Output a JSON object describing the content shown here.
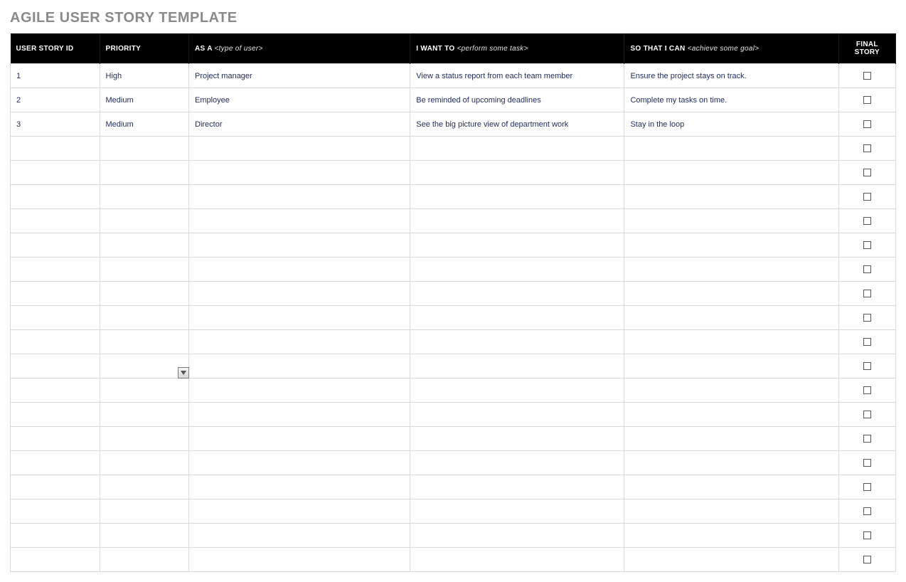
{
  "title": "AGILE USER STORY TEMPLATE",
  "columns": {
    "id": {
      "label": "USER STORY ID"
    },
    "prio": {
      "label": "PRIORITY"
    },
    "asa": {
      "label": "AS A",
      "hint": "<type of user>"
    },
    "want": {
      "label": "I WANT TO",
      "hint": "<perform some task>"
    },
    "goal": {
      "label": "SO THAT I CAN",
      "hint": "<achieve some goal>"
    },
    "final": {
      "label": "FINAL STORY"
    }
  },
  "rows": [
    {
      "id": "1",
      "prio": "High",
      "asa": "Project manager",
      "want": "View a status report from each team member",
      "goal": "Ensure the project stays on track.",
      "final": false
    },
    {
      "id": "2",
      "prio": "Medium",
      "asa": "Employee",
      "want": "Be reminded of upcoming deadlines",
      "goal": "Complete my tasks on time.",
      "final": false
    },
    {
      "id": "3",
      "prio": "Medium",
      "asa": "Director",
      "want": "See the big picture view of department work",
      "goal": "Stay in the loop",
      "final": false
    },
    {
      "id": "",
      "prio": "",
      "asa": "",
      "want": "",
      "goal": "",
      "final": false
    },
    {
      "id": "",
      "prio": "",
      "asa": "",
      "want": "",
      "goal": "",
      "final": false
    },
    {
      "id": "",
      "prio": "",
      "asa": "",
      "want": "",
      "goal": "",
      "final": false
    },
    {
      "id": "",
      "prio": "",
      "asa": "",
      "want": "",
      "goal": "",
      "final": false
    },
    {
      "id": "",
      "prio": "",
      "asa": "",
      "want": "",
      "goal": "",
      "final": false
    },
    {
      "id": "",
      "prio": "",
      "asa": "",
      "want": "",
      "goal": "",
      "final": false
    },
    {
      "id": "",
      "prio": "",
      "asa": "",
      "want": "",
      "goal": "",
      "final": false
    },
    {
      "id": "",
      "prio": "",
      "asa": "",
      "want": "",
      "goal": "",
      "final": false
    },
    {
      "id": "",
      "prio": "",
      "asa": "",
      "want": "",
      "goal": "",
      "final": false
    },
    {
      "id": "",
      "prio": "",
      "asa": "",
      "want": "",
      "goal": "",
      "final": false,
      "dropdown_on_prio": true
    },
    {
      "id": "",
      "prio": "",
      "asa": "",
      "want": "",
      "goal": "",
      "final": false
    },
    {
      "id": "",
      "prio": "",
      "asa": "",
      "want": "",
      "goal": "",
      "final": false
    },
    {
      "id": "",
      "prio": "",
      "asa": "",
      "want": "",
      "goal": "",
      "final": false
    },
    {
      "id": "",
      "prio": "",
      "asa": "",
      "want": "",
      "goal": "",
      "final": false
    },
    {
      "id": "",
      "prio": "",
      "asa": "",
      "want": "",
      "goal": "",
      "final": false
    },
    {
      "id": "",
      "prio": "",
      "asa": "",
      "want": "",
      "goal": "",
      "final": false
    },
    {
      "id": "",
      "prio": "",
      "asa": "",
      "want": "",
      "goal": "",
      "final": false
    },
    {
      "id": "",
      "prio": "",
      "asa": "",
      "want": "",
      "goal": "",
      "final": false
    }
  ]
}
